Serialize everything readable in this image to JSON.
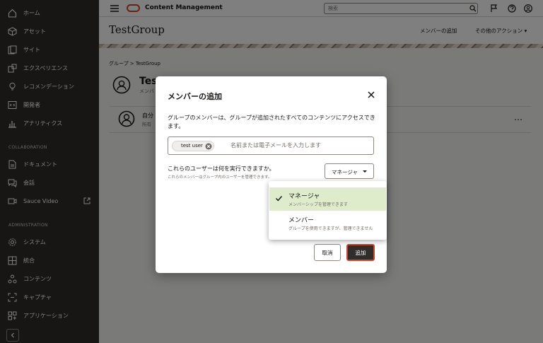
{
  "colors": {
    "sidebar_bg": "#312d2a",
    "brand": "#c74634",
    "selected_option_bg": "#dfeccb"
  },
  "sidebar": {
    "items": [
      {
        "label": "ホーム",
        "icon": "home-icon"
      },
      {
        "label": "アセット",
        "icon": "cube-icon"
      },
      {
        "label": "サイト",
        "icon": "sites-icon"
      },
      {
        "label": "エクスペリエンス",
        "icon": "experience-icon"
      },
      {
        "label": "レコメンデーション",
        "icon": "lightbulb-icon"
      },
      {
        "label": "開発者",
        "icon": "code-icon"
      },
      {
        "label": "アナリティクス",
        "icon": "chart-icon"
      }
    ],
    "section_collab": "COLLABORATION",
    "collab_items": [
      {
        "label": "ドキュメント",
        "icon": "document-icon"
      },
      {
        "label": "会話",
        "icon": "conversation-icon"
      },
      {
        "label": "Sauce Video",
        "icon": "video-icon"
      }
    ],
    "section_admin": "ADMINISTRATION",
    "admin_items": [
      {
        "label": "システム",
        "icon": "gear-icon"
      },
      {
        "label": "統合",
        "icon": "integration-icon"
      },
      {
        "label": "コンテンツ",
        "icon": "content-icon"
      },
      {
        "label": "キャプチャ",
        "icon": "capture-icon"
      },
      {
        "label": "アプリケーション",
        "icon": "apps-icon"
      }
    ]
  },
  "topbar": {
    "title": "Content Management",
    "search_placeholder": "検索"
  },
  "page": {
    "title": "TestGroup",
    "add_member": "メンバーの追加",
    "other_actions": "その他のアクション",
    "breadcrumb": "グループ > TestGroup",
    "group_name": "Tes",
    "group_sub": "メンバ",
    "member_name": "自分",
    "member_sub": "所有",
    "member_more": "…"
  },
  "dialog": {
    "title": "メンバーの追加",
    "description": "グループのメンバーは、グループが追加されたすべてのコンテンツにアクセスできます。",
    "chip": "test user",
    "input_placeholder": "名前または電子メールを入力します",
    "role_question": "これらのユーザーは何を実行できますか。",
    "role_hint": "これらのメンバーはグループ内のユーザーを管理できます。",
    "role_selected": "マネージャ",
    "cancel": "取消",
    "add": "追加"
  },
  "role_menu": {
    "options": [
      {
        "name": "マネージャ",
        "desc": "メンバーシップを管理できます",
        "selected": true
      },
      {
        "name": "メンバー",
        "desc": "グループを使用できますが、管理できません",
        "selected": false
      }
    ]
  }
}
